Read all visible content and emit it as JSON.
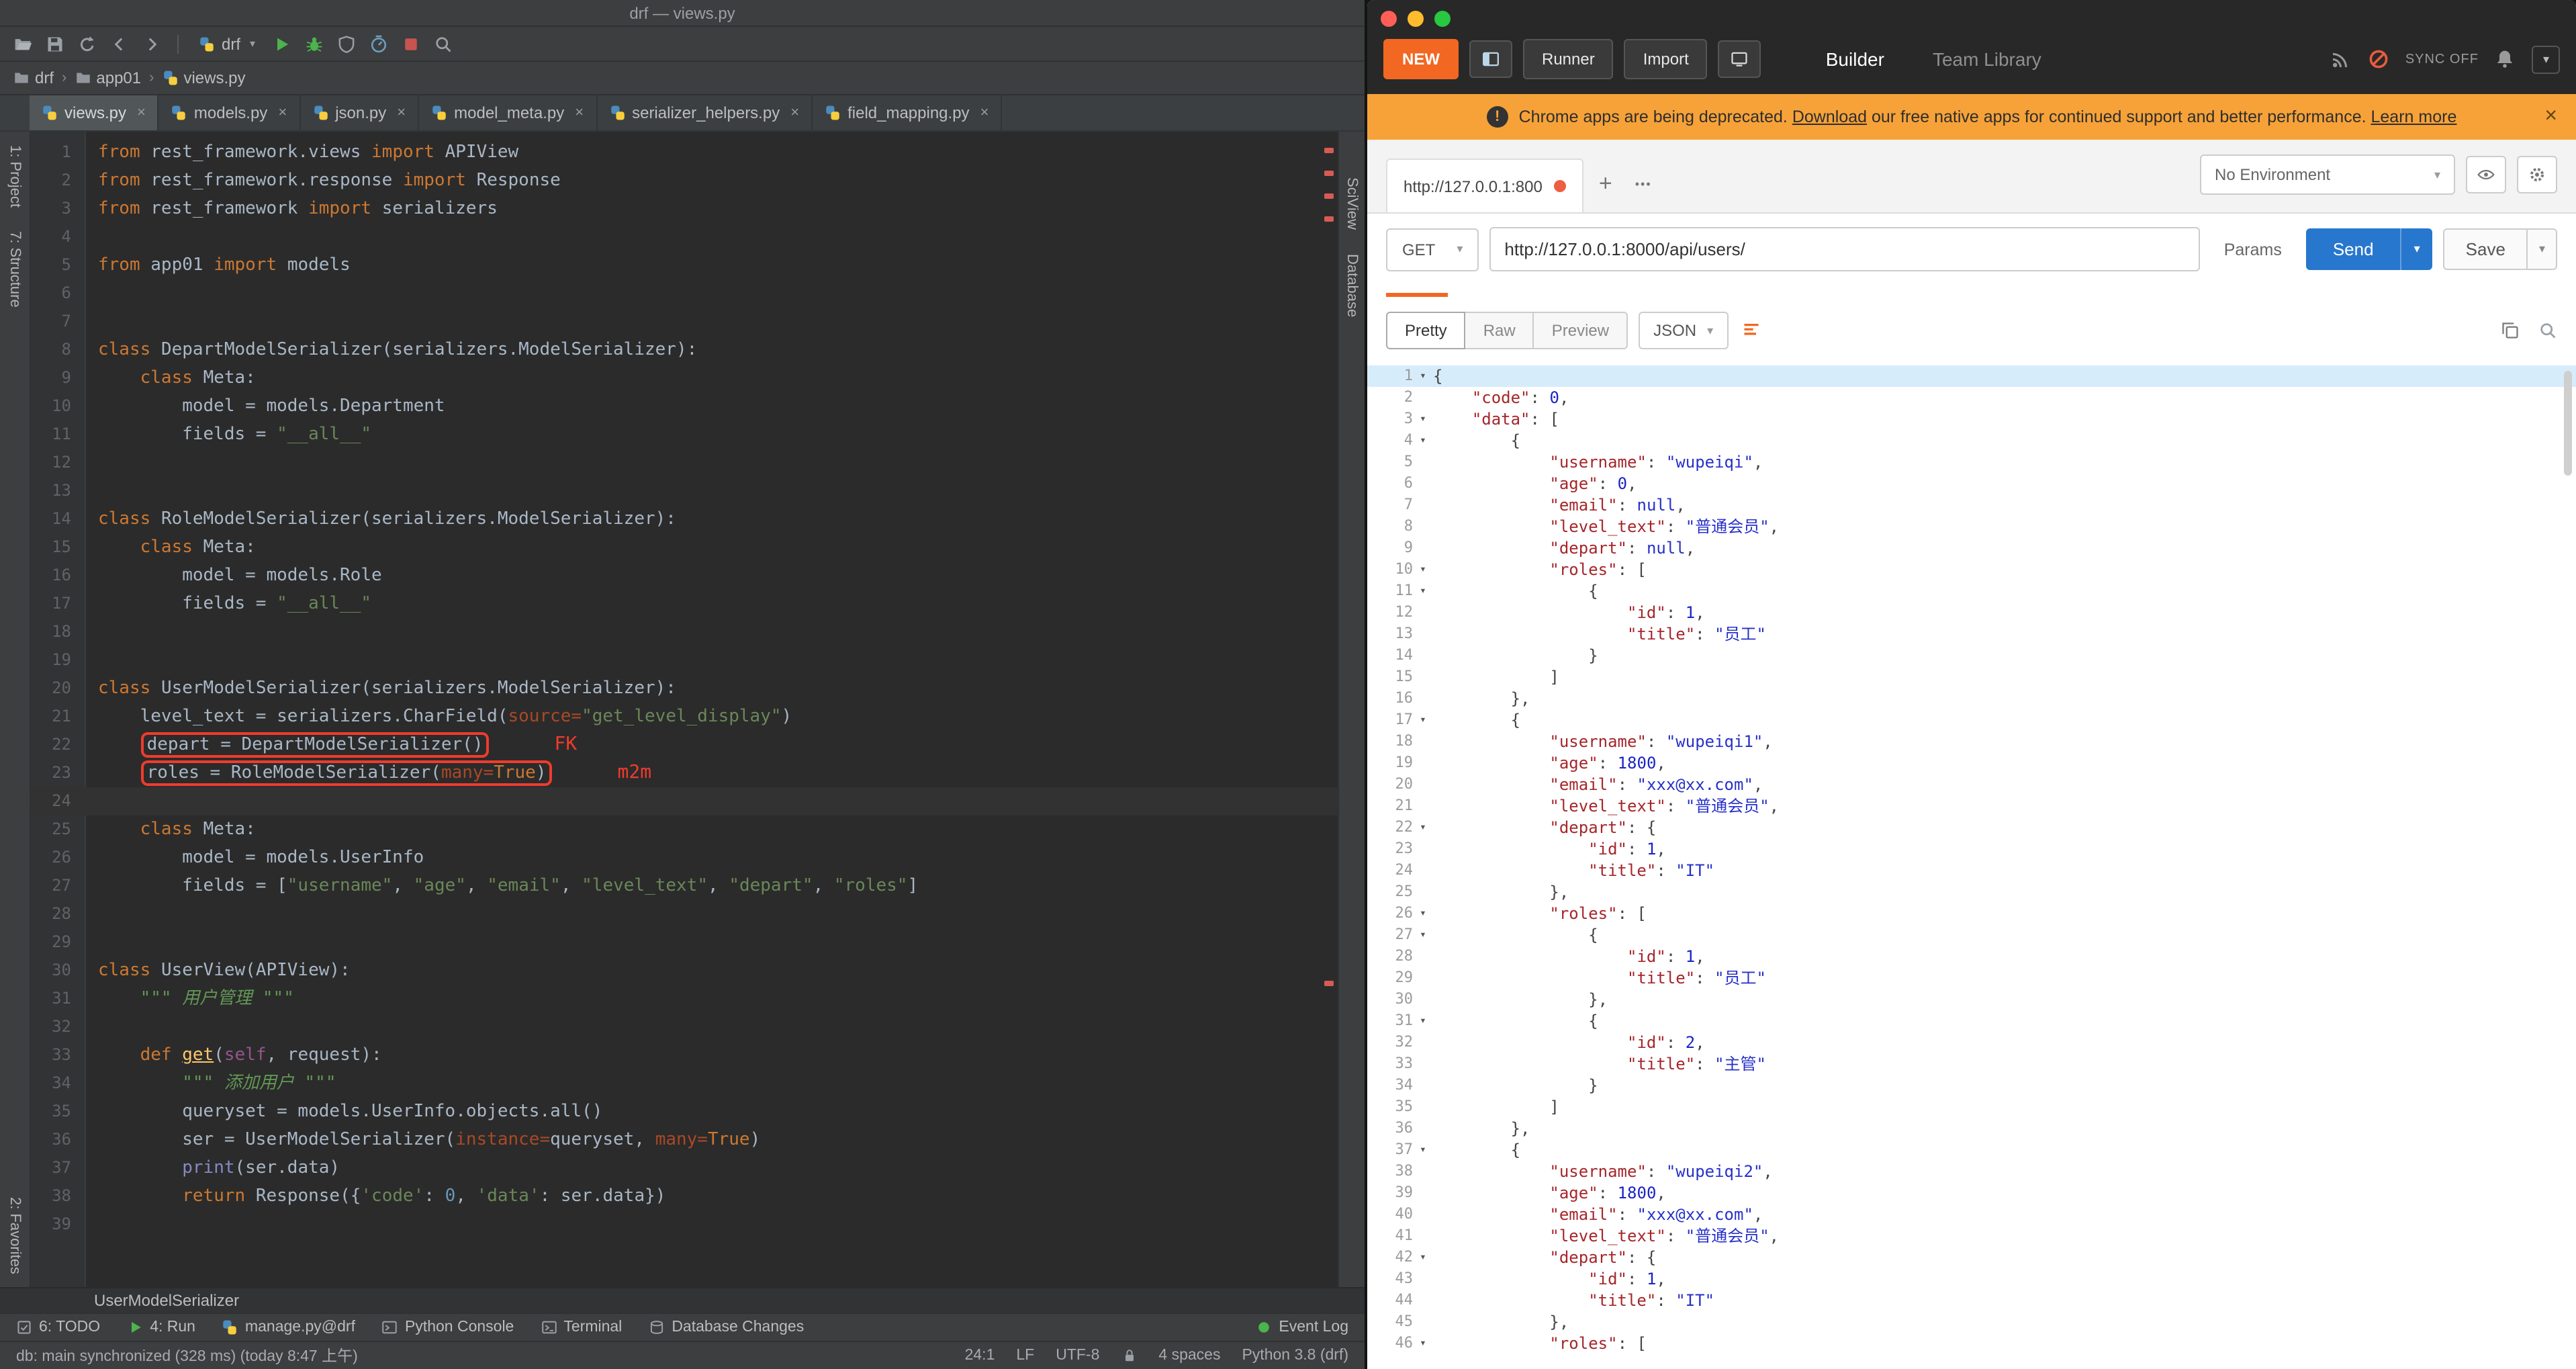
{
  "pycharm": {
    "window_title": "drf — views.py",
    "toolbar": {
      "left_icons": [
        "open",
        "save",
        "sync",
        "back",
        "forward"
      ],
      "run_config": "drf",
      "right_icons": [
        "run",
        "debug",
        "coverage",
        "profiler",
        "stop",
        "search"
      ]
    },
    "breadcrumbs": [
      {
        "icon": "folder",
        "label": "drf"
      },
      {
        "icon": "folder",
        "label": "app01"
      },
      {
        "icon": "python",
        "label": "views.py"
      }
    ],
    "tabs": [
      {
        "label": "views.py",
        "active": true
      },
      {
        "label": "models.py",
        "active": false
      },
      {
        "label": "json.py",
        "active": false
      },
      {
        "label": "model_meta.py",
        "active": false
      },
      {
        "label": "serializer_helpers.py",
        "active": false
      },
      {
        "label": "field_mapping.py",
        "active": false
      }
    ],
    "left_strip": {
      "top": [
        "1: Project",
        "7: Structure"
      ],
      "bottom": [
        "2: Favorites"
      ]
    },
    "right_strip": [
      "SciView",
      "Database"
    ],
    "editor": {
      "lines": [
        {
          "s": [
            [
              "k",
              "from "
            ],
            [
              "p",
              "rest_framework.views "
            ],
            [
              "k",
              "import "
            ],
            [
              "p",
              "APIView"
            ]
          ]
        },
        {
          "s": [
            [
              "k",
              "from "
            ],
            [
              "p",
              "rest_framework.response "
            ],
            [
              "k",
              "import "
            ],
            [
              "p",
              "Response"
            ]
          ]
        },
        {
          "s": [
            [
              "k",
              "from "
            ],
            [
              "p",
              "rest_framework "
            ],
            [
              "k",
              "import "
            ],
            [
              "p",
              "serializers"
            ]
          ]
        },
        {
          "s": []
        },
        {
          "s": [
            [
              "k",
              "from "
            ],
            [
              "p",
              "app01 "
            ],
            [
              "k",
              "import "
            ],
            [
              "p",
              "models"
            ]
          ]
        },
        {
          "s": []
        },
        {
          "s": []
        },
        {
          "s": [
            [
              "k",
              "class "
            ],
            [
              "p",
              "DepartModelSerializer(serializers.ModelSerializer):"
            ]
          ]
        },
        {
          "s": [
            [
              "p",
              "    "
            ],
            [
              "k",
              "class "
            ],
            [
              "p",
              "Meta:"
            ]
          ]
        },
        {
          "s": [
            [
              "p",
              "        model = models.Department"
            ]
          ]
        },
        {
          "s": [
            [
              "p",
              "        fields = "
            ],
            [
              "s",
              "\"__all__\""
            ]
          ]
        },
        {
          "s": []
        },
        {
          "s": []
        },
        {
          "s": [
            [
              "k",
              "class "
            ],
            [
              "p",
              "RoleModelSerializer(serializers.ModelSerializer):"
            ]
          ]
        },
        {
          "s": [
            [
              "p",
              "    "
            ],
            [
              "k",
              "class "
            ],
            [
              "p",
              "Meta:"
            ]
          ]
        },
        {
          "s": [
            [
              "p",
              "        model = models.Role"
            ]
          ]
        },
        {
          "s": [
            [
              "p",
              "        fields = "
            ],
            [
              "s",
              "\"__all__\""
            ]
          ]
        },
        {
          "s": []
        },
        {
          "s": []
        },
        {
          "s": [
            [
              "k",
              "class "
            ],
            [
              "p",
              "UserModelSerializer(serializers.ModelSerializer):"
            ]
          ]
        },
        {
          "s": [
            [
              "p",
              "    level_text = serializers.CharField("
            ],
            [
              "a",
              "source="
            ],
            [
              "s",
              "\"get_level_display\""
            ],
            [
              "p",
              ")"
            ]
          ]
        },
        {
          "s": [
            [
              "p",
              "    "
            ],
            [
              "p",
              "depart = DepartModelSerializer()"
            ]
          ],
          "box": [
            1,
            1
          ],
          "note": "FK"
        },
        {
          "s": [
            [
              "p",
              "    "
            ],
            [
              "p",
              "roles = RoleModelSerializer("
            ],
            [
              "a",
              "many="
            ],
            [
              "k",
              "True"
            ],
            [
              "p",
              ")"
            ]
          ],
          "box": [
            1,
            4
          ],
          "note": "m2m"
        },
        {
          "s": [],
          "cur": true
        },
        {
          "s": [
            [
              "p",
              "    "
            ],
            [
              "k",
              "class "
            ],
            [
              "p",
              "Meta:"
            ]
          ]
        },
        {
          "s": [
            [
              "p",
              "        model = models.UserInfo"
            ]
          ]
        },
        {
          "s": [
            [
              "p",
              "        fields = ["
            ],
            [
              "s",
              "\"username\""
            ],
            [
              "p",
              ", "
            ],
            [
              "s",
              "\"age\""
            ],
            [
              "p",
              ", "
            ],
            [
              "s",
              "\"email\""
            ],
            [
              "p",
              ", "
            ],
            [
              "s",
              "\"level_text\""
            ],
            [
              "p",
              ", "
            ],
            [
              "s",
              "\"depart\""
            ],
            [
              "p",
              ", "
            ],
            [
              "s",
              "\"roles\""
            ],
            [
              "p",
              "]"
            ]
          ]
        },
        {
          "s": []
        },
        {
          "s": []
        },
        {
          "s": [
            [
              "k",
              "class "
            ],
            [
              "p",
              "UserView(APIView):"
            ]
          ]
        },
        {
          "s": [
            [
              "p",
              "    "
            ],
            [
              "d",
              "\"\"\" 用户管理 \"\"\""
            ]
          ]
        },
        {
          "s": []
        },
        {
          "s": [
            [
              "p",
              "    "
            ],
            [
              "k",
              "def "
            ],
            [
              "fu",
              "get"
            ],
            [
              "p",
              "("
            ],
            [
              "sf",
              "self"
            ],
            [
              "p",
              ", request):"
            ]
          ]
        },
        {
          "s": [
            [
              "p",
              "        "
            ],
            [
              "d",
              "\"\"\" 添加用户 \"\"\""
            ]
          ]
        },
        {
          "s": [
            [
              "p",
              "        queryset = models.UserInfo.objects.all()"
            ]
          ]
        },
        {
          "s": [
            [
              "p",
              "        ser = UserModelSerializer("
            ],
            [
              "a",
              "instance="
            ],
            [
              "p",
              "queryset, "
            ],
            [
              "a",
              "many="
            ],
            [
              "k",
              "True"
            ],
            [
              "p",
              ")"
            ]
          ]
        },
        {
          "s": [
            [
              "p",
              "        "
            ],
            [
              "b",
              "print"
            ],
            [
              "p",
              "(ser.data)"
            ]
          ]
        },
        {
          "s": [
            [
              "p",
              "        "
            ],
            [
              "k",
              "return "
            ],
            [
              "p",
              "Response({"
            ],
            [
              "s",
              "'code'"
            ],
            [
              "p",
              ": "
            ],
            [
              "n",
              "0"
            ],
            [
              "p",
              ", "
            ],
            [
              "s",
              "'data'"
            ],
            [
              "p",
              ": ser.data})"
            ]
          ]
        },
        {
          "s": []
        }
      ]
    },
    "footer_breadcrumb": "UserModelSerializer",
    "status_items": [
      {
        "icon": "todo",
        "label": "6: TODO"
      },
      {
        "icon": "run",
        "label": "4: Run"
      },
      {
        "icon": "python",
        "label": "manage.py@drf"
      },
      {
        "icon": "console",
        "label": "Python Console"
      },
      {
        "icon": "terminal",
        "label": "Terminal"
      },
      {
        "icon": "db",
        "label": "Database Changes"
      }
    ],
    "event_log": "Event Log",
    "bottom_left": "db: main synchronized (328 ms) (today 8:47 上午)",
    "bottom_right": [
      {
        "text": "24:1"
      },
      {
        "text": "LF"
      },
      {
        "text": "UTF-8"
      },
      {
        "icon": "lock"
      },
      {
        "text": "4 spaces"
      },
      {
        "text": "Python 3.8 (drf)"
      }
    ]
  },
  "postman": {
    "header": {
      "left": [
        {
          "text": "NEW",
          "style": "orange"
        },
        {
          "icon": "pane-toggle"
        },
        {
          "text": "Runner"
        },
        {
          "text": "Import"
        },
        {
          "icon": "new-window"
        }
      ],
      "builder": "Builder",
      "team_library": "Team Library",
      "right": [
        {
          "icon": "interceptor"
        },
        {
          "icon": "sync-disabled"
        },
        {
          "text": "SYNC OFF"
        },
        {
          "icon": "bell"
        },
        {
          "icon": "account"
        }
      ]
    },
    "banner": {
      "text_before": "Chrome apps are being deprecated. ",
      "download_link": "Download",
      "text_middle": " our free native apps for continued support and better performance. ",
      "learn_more_link": "Learn more",
      "close": "×"
    },
    "tabstrip": {
      "tab": "http://127.0.0.1:800",
      "new_tab": "+",
      "more": "•••",
      "environment": "No Environment"
    },
    "request": {
      "method": "GET",
      "url": "http://127.0.0.1:8000/api/users/",
      "params": "Params",
      "send": "Send",
      "save": "Save"
    },
    "response": {
      "views": [
        "Pretty",
        "Raw",
        "Preview"
      ],
      "active_view": "Pretty",
      "format": "JSON",
      "lines": [
        "{",
        "    \"code\": 0,",
        "    \"data\": [",
        "        {",
        "            \"username\": \"wupeiqi\",",
        "            \"age\": 0,",
        "            \"email\": null,",
        "            \"level_text\": \"普通会员\",",
        "            \"depart\": null,",
        "            \"roles\": [",
        "                {",
        "                    \"id\": 1,",
        "                    \"title\": \"员工\"",
        "                }",
        "            ]",
        "        },",
        "        {",
        "            \"username\": \"wupeiqi1\",",
        "            \"age\": 1800,",
        "            \"email\": \"xxx@xx.com\",",
        "            \"level_text\": \"普通会员\",",
        "            \"depart\": {",
        "                \"id\": 1,",
        "                \"title\": \"IT\"",
        "            },",
        "            \"roles\": [",
        "                {",
        "                    \"id\": 1,",
        "                    \"title\": \"员工\"",
        "                },",
        "                {",
        "                    \"id\": 2,",
        "                    \"title\": \"主管\"",
        "                }",
        "            ]",
        "        },",
        "        {",
        "            \"username\": \"wupeiqi2\",",
        "            \"age\": 1800,",
        "            \"email\": \"xxx@xx.com\",",
        "            \"level_text\": \"普通会员\",",
        "            \"depart\": {",
        "                \"id\": 1,",
        "                \"title\": \"IT\"",
        "            },",
        "            \"roles\": ["
      ]
    }
  }
}
